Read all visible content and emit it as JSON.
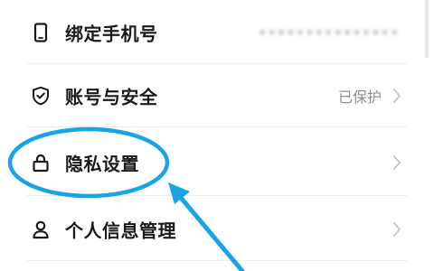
{
  "settings": {
    "rows": [
      {
        "key": "bind-phone",
        "label": "绑定手机号",
        "value": "•••••••••••••••",
        "icon": "phone-icon"
      },
      {
        "key": "account-security",
        "label": "账号与安全",
        "value": "已保护",
        "icon": "shield-check-icon"
      },
      {
        "key": "privacy-settings",
        "label": "隐私设置",
        "value": "",
        "icon": "lock-icon"
      },
      {
        "key": "personal-info",
        "label": "个人信息管理",
        "value": "",
        "icon": "person-icon"
      }
    ]
  },
  "colors": {
    "annotation": "#1aa3e6",
    "text": "#1a1a1a",
    "secondary": "#8f8f8f",
    "chevron": "#c6c6c6"
  }
}
